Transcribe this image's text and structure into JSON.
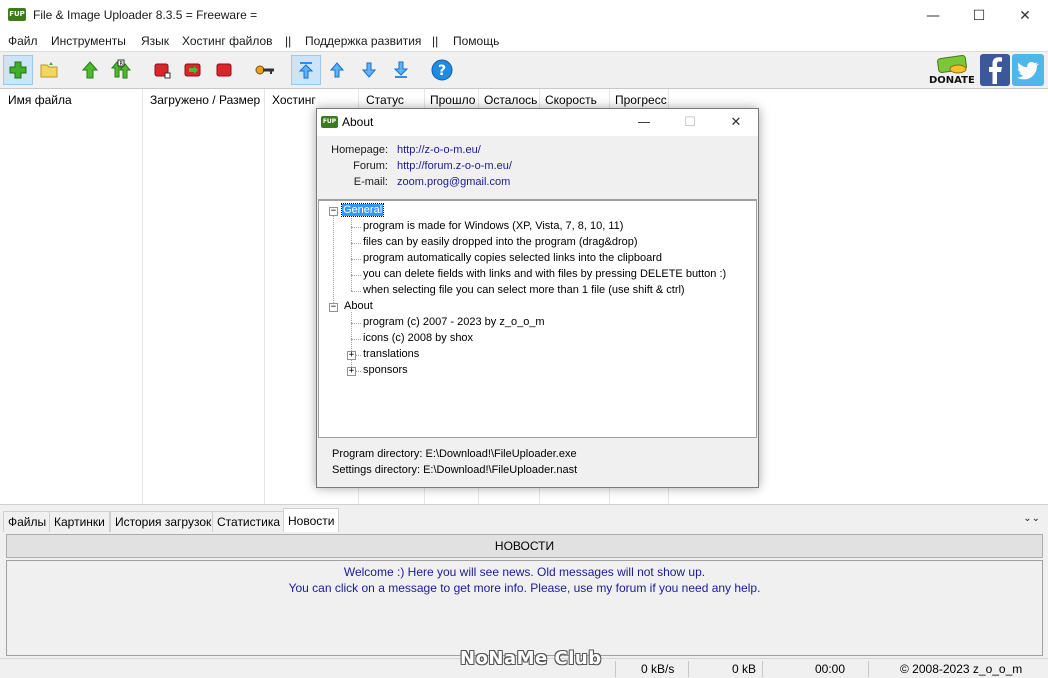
{
  "window": {
    "title": "File & Image Uploader 8.3.5  = Freeware =",
    "icon_text": "FUP",
    "minimize": "—",
    "maximize": "☐",
    "close": "✕"
  },
  "menu": [
    "Файл",
    "Инструменты",
    "Язык",
    "Хостинг файлов",
    "||",
    "Поддержка развития",
    "||",
    "Помощь"
  ],
  "toolbar": {
    "donate_label": "DONATE",
    "help_label": "?"
  },
  "columns": [
    "Имя файла",
    "Загружено / Размер",
    "Хостинг",
    "Статус",
    "Прошло",
    "Осталось",
    "Скорость",
    "Прогресс"
  ],
  "tabs": [
    "Файлы",
    "Картинки",
    "История загрузок",
    "Статистика",
    "Новости"
  ],
  "active_tab": "Новости",
  "news": {
    "header": "НОВОСТИ",
    "line1": "Welcome :) Here you will see news. Old messages will not show up.",
    "line2": "You can click on a message to get more info. Please, use my forum if you need any help."
  },
  "status": {
    "speed": "0 kB/s",
    "size": "0 kB",
    "time": "00:00",
    "copyright": "© 2008-2023 z_o_o_m"
  },
  "watermark": "NoNaMe Club",
  "about": {
    "title": "About",
    "icon_text": "FUP",
    "homepage_label": "Homepage:",
    "homepage": "http://z-o-o-m.eu/",
    "forum_label": "Forum:",
    "forum": "http://forum.z-o-o-m.eu/",
    "email_label": "E-mail:",
    "email": "zoom.prog@gmail.com",
    "tree": {
      "general": "General",
      "general_items": [
        "program is made for Windows (XP, Vista, 7, 8, 10, 11)",
        "files can by easily dropped into the program (drag&drop)",
        "program automatically copies selected links into the clipboard",
        "you can delete fields with links and with files by pressing DELETE button :)",
        "when selecting file you can select more than 1 file (use shift & ctrl)"
      ],
      "about": "About",
      "about_items": [
        "program (c) 2007 - 2023 by z_o_o_m",
        "icons (c) 2008 by shox"
      ],
      "translations": "translations",
      "sponsors": "sponsors",
      "collapse_sign": "−",
      "expand_sign": "+"
    },
    "program_dir": "Program directory: E:\\Download!\\FileUploader.exe",
    "settings_dir": "Settings directory: E:\\Download!\\FileUploader.nast"
  },
  "colors": {
    "link": "#1a1a9c",
    "selection": "#3399ff",
    "toolbar_bg": "#f0f0f0"
  }
}
